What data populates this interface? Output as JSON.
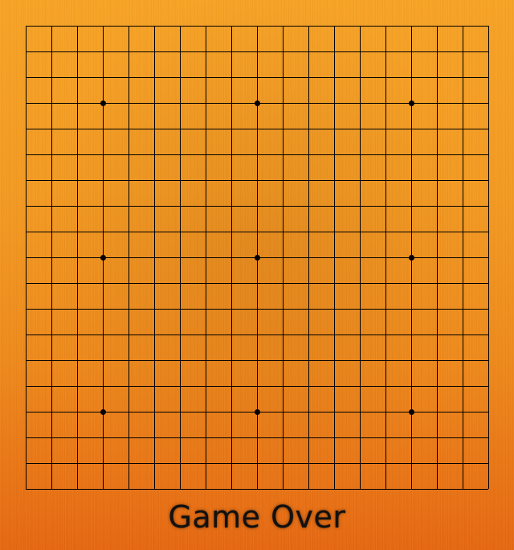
{
  "game": {
    "type": "go",
    "board_size": 19,
    "star_points": [
      [
        3,
        3
      ],
      [
        3,
        9
      ],
      [
        3,
        15
      ],
      [
        9,
        3
      ],
      [
        9,
        9
      ],
      [
        9,
        15
      ],
      [
        15,
        3
      ],
      [
        15,
        9
      ],
      [
        15,
        15
      ]
    ],
    "stones": []
  },
  "status": {
    "text": "Game Over"
  },
  "colors": {
    "grid_line": "#000000",
    "star_point": "#000000",
    "board_top": "#f7a326",
    "board_bottom": "#e66812",
    "status_text": "#111111"
  }
}
